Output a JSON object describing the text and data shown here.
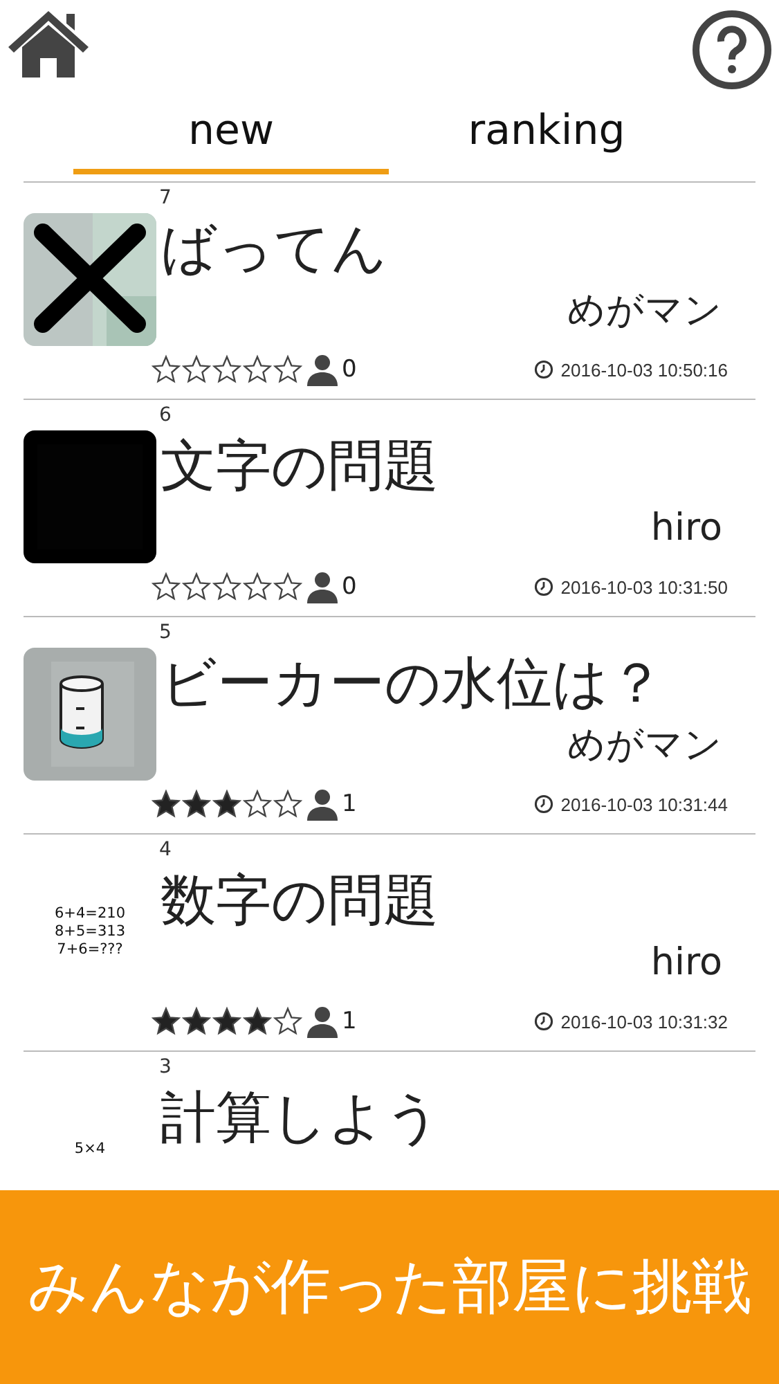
{
  "tabs": [
    {
      "label": "new",
      "selected": true
    },
    {
      "label": "ranking",
      "selected": false
    }
  ],
  "rooms": [
    {
      "number": "7",
      "title": "ばってん",
      "author": "めがマン",
      "stars": 0,
      "players": "0",
      "timestamp": "2016-10-03 10:50:16"
    },
    {
      "number": "6",
      "title": "文字の問題",
      "author": "hiro",
      "stars": 0,
      "players": "0",
      "timestamp": "2016-10-03 10:31:50"
    },
    {
      "number": "5",
      "title": "ビーカーの水位は？",
      "author": "めがマン",
      "stars": 3,
      "players": "1",
      "timestamp": "2016-10-03 10:31:44"
    },
    {
      "number": "4",
      "title": "数字の問題",
      "author": "hiro",
      "stars": 4,
      "players": "1",
      "timestamp": "2016-10-03 10:31:32",
      "thumbnail": {
        "kind": "text",
        "lines": [
          "6+4=210",
          "8+5=313",
          "7+6=???"
        ]
      }
    },
    {
      "number": "3",
      "title": "計算しよう",
      "thumbnail": {
        "kind": "text",
        "lines": [
          "5×4"
        ]
      }
    }
  ],
  "banner": "みんなが作った部屋に挑戦"
}
